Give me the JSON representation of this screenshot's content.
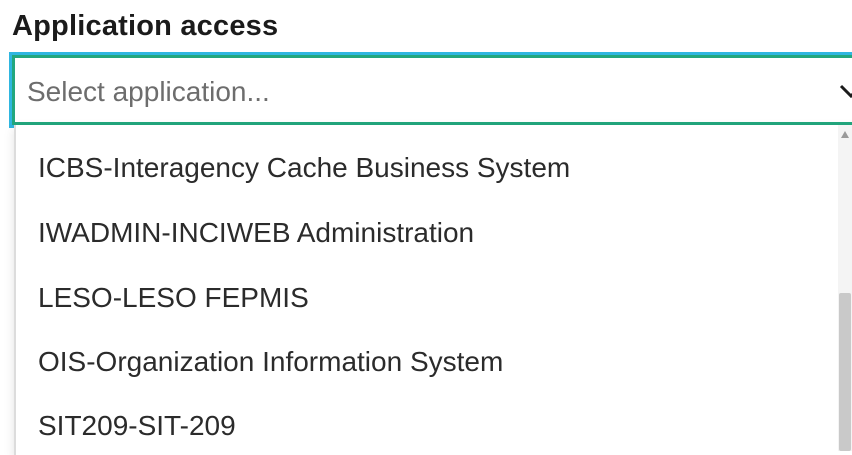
{
  "field": {
    "label": "Application access",
    "placeholder": "Select application..."
  },
  "dropdown": {
    "options": [
      "ICBS-Interagency Cache Business System",
      "IWADMIN-INCIWEB Administration",
      "LESO-LESO FEPMIS",
      "OIS-Organization Information System",
      "SIT209-SIT-209"
    ]
  },
  "colors": {
    "focus_border": "#22a77e",
    "focus_outline": "#2fb6e0"
  }
}
